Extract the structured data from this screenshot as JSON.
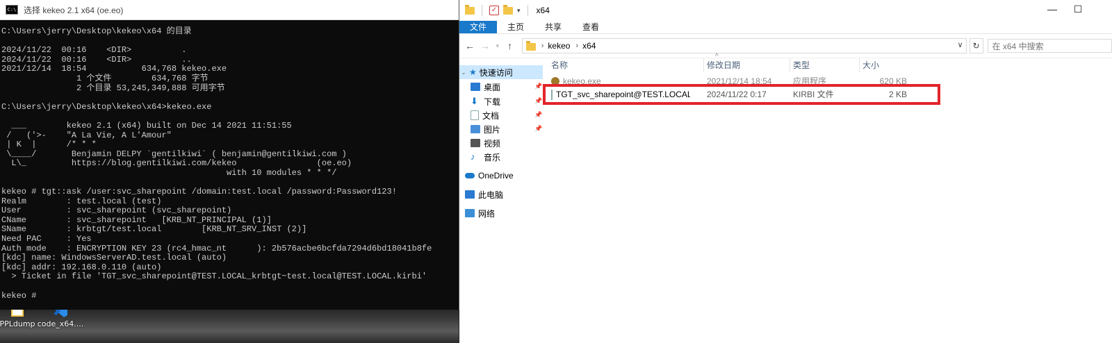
{
  "console": {
    "title": "选择 kekeo 2.1 x64 (oe.eo)",
    "icon_text": "C:\\",
    "lines": [
      "C:\\Users\\jerry\\Desktop\\kekeo\\x64 的目录",
      "",
      "2024/11/22  00:16    <DIR>          .",
      "2024/11/22  00:16    <DIR>          ..",
      "2021/12/14  18:54           634,768 kekeo.exe",
      "               1 个文件        634,768 字节",
      "               2 个目录 53,245,349,888 可用字节",
      "",
      "C:\\Users\\jerry\\Desktop\\kekeo\\x64>kekeo.exe",
      "",
      "  ___        kekeo 2.1 (x64) built on Dec 14 2021 11:51:55",
      " /   ('>-    \"A La Vie, A L'Amour\"",
      " | K  |      /* * *",
      " \\____/       Benjamin DELPY `gentilkiwi` ( benjamin@gentilkiwi.com )",
      "  L\\_         https://blog.gentilkiwi.com/kekeo                (oe.eo)",
      "                                             with 10 modules * * */",
      "",
      "kekeo # tgt::ask /user:svc_sharepoint /domain:test.local /password:Password123!",
      "Realm        : test.local (test)",
      "User         : svc_sharepoint (svc_sharepoint)",
      "CName        : svc_sharepoint   [KRB_NT_PRINCIPAL (1)]",
      "SName        : krbtgt/test.local        [KRB_NT_SRV_INST (2)]",
      "Need PAC     : Yes",
      "Auth mode    : ENCRYPTION KEY 23 (rc4_hmac_nt      ): 2b576acbe6bcfda7294d6bd18041b8fe",
      "[kdc] name: WindowsServerAD.test.local (auto)",
      "[kdc] addr: 192.168.0.110 (auto)",
      "  > Ticket in file 'TGT_svc_sharepoint@TEST.LOCAL_krbtgt~test.local@TEST.LOCAL.kirbi'",
      "",
      "kekeo #"
    ]
  },
  "desktop": {
    "icons": [
      {
        "label": "PPLdump",
        "icon": "ppldump-icon"
      },
      {
        "label": "code_x64....",
        "icon": "vscode-icon"
      }
    ]
  },
  "explorer": {
    "title": "x64",
    "window_controls": {
      "minimize": "—",
      "maximize": "☐"
    },
    "ribbon_tabs": [
      "文件",
      "主页",
      "共享",
      "查看"
    ],
    "breadcrumb": [
      "kekeo",
      "x64"
    ],
    "search_placeholder": "在 x64 中搜索",
    "nav": {
      "quick_access": "快速访问",
      "items": [
        "桌面",
        "下载",
        "文档",
        "图片",
        "视频",
        "音乐"
      ],
      "onedrive": "OneDrive",
      "this_pc": "此电脑",
      "network": "网络"
    },
    "columns": [
      "名称",
      "修改日期",
      "类型",
      "大小"
    ],
    "files": [
      {
        "name": "kekeo.exe",
        "date": "2021/12/14 18:54",
        "type": "应用程序",
        "size": "620 KB"
      },
      {
        "name": "TGT_svc_sharepoint@TEST.LOCAL_kr...",
        "date": "2024/11/22 0:17",
        "type": "KIRBI 文件",
        "size": "2 KB"
      }
    ]
  },
  "colors": {
    "accent": "#1979ca",
    "highlight": "#e3242b",
    "console_bg": "#0c0c0c"
  }
}
